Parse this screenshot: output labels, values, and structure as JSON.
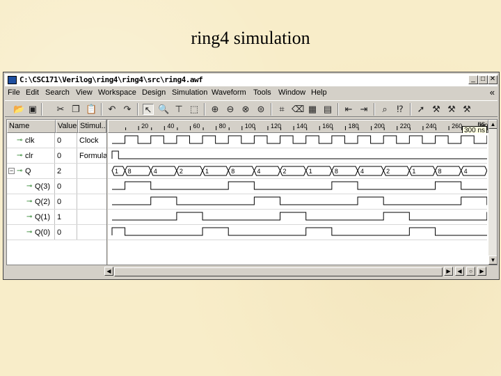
{
  "slide": {
    "title": "ring4 simulation"
  },
  "window": {
    "title": "C:\\CSC171\\Verilog\\ring4\\ring4\\src\\ring4.awf",
    "min_glyph": "_",
    "max_glyph": "□",
    "close_glyph": "✕"
  },
  "menu": {
    "items": [
      "File",
      "Edit",
      "Search",
      "View",
      "Workspace",
      "Design",
      "Simulation",
      "Waveform",
      "Tools",
      "Window",
      "Help"
    ],
    "overflow_glyph": "«"
  },
  "toolbar": {
    "icons": [
      "open-folder",
      "save",
      "cut",
      "copy",
      "paste",
      "undo",
      "redo",
      "select-pointer",
      "zoom",
      "move-cursor",
      "select-area",
      "zoom-in",
      "zoom-out",
      "zoom-fit",
      "zoom-range",
      "add-signal",
      "delete-signal",
      "signal-properties",
      "bus-edit",
      "edge-prev",
      "edge-next",
      "stimulus",
      "find",
      "bookmark",
      "run",
      "step",
      "stop",
      "restart"
    ]
  },
  "columns": {
    "name": "Name",
    "value": "Value",
    "stimulator": "Stimul..."
  },
  "signals": [
    {
      "name": "clk",
      "value": "0",
      "stim": "Clock",
      "indent": 0,
      "expander": ""
    },
    {
      "name": "clr",
      "value": "0",
      "stim": "Formula",
      "indent": 0,
      "expander": ""
    },
    {
      "name": "Q",
      "value": "2",
      "stim": "",
      "indent": 0,
      "expander": "−"
    },
    {
      "name": "Q(3)",
      "value": "0",
      "stim": "",
      "indent": 1,
      "expander": ""
    },
    {
      "name": "Q(2)",
      "value": "0",
      "stim": "",
      "indent": 1,
      "expander": ""
    },
    {
      "name": "Q(1)",
      "value": "1",
      "stim": "",
      "indent": 1,
      "expander": ""
    },
    {
      "name": "Q(0)",
      "value": "0",
      "stim": "",
      "indent": 1,
      "expander": ""
    }
  ],
  "timeline": {
    "unit": "ns",
    "ticks": [
      20,
      40,
      60,
      80,
      100,
      120,
      140,
      160,
      180,
      200,
      220,
      240,
      260,
      280
    ],
    "cursor_label": "300 ns",
    "view_start": 0,
    "view_end": 295
  },
  "waveforms": {
    "clk_period": 20,
    "clr_low_from": 5,
    "q_segments": [
      {
        "start": 0,
        "end": 10,
        "label": "1"
      },
      {
        "start": 10,
        "end": 30,
        "label": "8"
      },
      {
        "start": 30,
        "end": 50,
        "label": "4"
      },
      {
        "start": 50,
        "end": 70,
        "label": "2"
      },
      {
        "start": 70,
        "end": 90,
        "label": "1"
      },
      {
        "start": 90,
        "end": 110,
        "label": "8"
      },
      {
        "start": 110,
        "end": 130,
        "label": "4"
      },
      {
        "start": 130,
        "end": 150,
        "label": "2"
      },
      {
        "start": 150,
        "end": 170,
        "label": "1"
      },
      {
        "start": 170,
        "end": 190,
        "label": "8"
      },
      {
        "start": 190,
        "end": 210,
        "label": "4"
      },
      {
        "start": 210,
        "end": 230,
        "label": "2"
      },
      {
        "start": 230,
        "end": 250,
        "label": "1"
      },
      {
        "start": 250,
        "end": 270,
        "label": "8"
      },
      {
        "start": 270,
        "end": 290,
        "label": "4"
      },
      {
        "start": 290,
        "end": 295,
        "label": "2"
      }
    ],
    "q3_high": [
      [
        10,
        30
      ],
      [
        90,
        110
      ],
      [
        170,
        190
      ],
      [
        250,
        270
      ]
    ],
    "q2_high": [
      [
        30,
        50
      ],
      [
        110,
        130
      ],
      [
        190,
        210
      ],
      [
        270,
        290
      ]
    ],
    "q1_high": [
      [
        50,
        70
      ],
      [
        130,
        150
      ],
      [
        210,
        230
      ],
      [
        290,
        295
      ]
    ],
    "q0_high": [
      [
        0,
        10
      ],
      [
        70,
        90
      ],
      [
        150,
        170
      ],
      [
        230,
        250
      ]
    ]
  },
  "hscroll": {
    "right_glyphs": [
      "▶",
      "◀",
      "○",
      "▶"
    ]
  }
}
